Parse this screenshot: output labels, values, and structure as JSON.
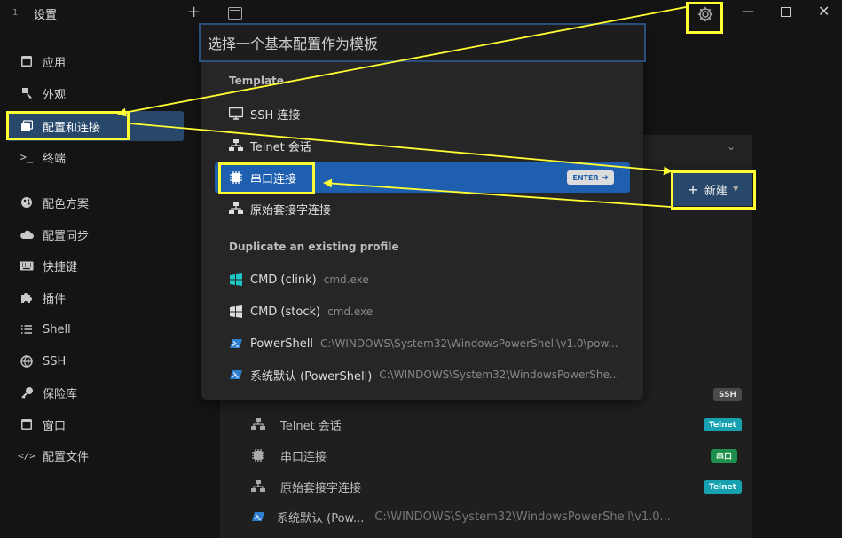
{
  "titlebar": {
    "tab_number": "1",
    "title": "设置"
  },
  "sidebar": {
    "items": [
      {
        "label": "应用",
        "icon": "app-window-icon"
      },
      {
        "label": "外观",
        "icon": "palette-icon"
      },
      {
        "label": "配置和连接",
        "icon": "profiles-icon",
        "active": true
      },
      {
        "label": "终端",
        "icon": "terminal-icon"
      },
      {
        "label": "配色方案",
        "icon": "color-scheme-icon"
      },
      {
        "label": "配置同步",
        "icon": "cloud-icon"
      },
      {
        "label": "快捷键",
        "icon": "keyboard-icon"
      },
      {
        "label": "插件",
        "icon": "puzzle-icon"
      },
      {
        "label": "Shell",
        "icon": "list-icon"
      },
      {
        "label": "SSH",
        "icon": "globe-icon"
      },
      {
        "label": "保险库",
        "icon": "key-icon"
      },
      {
        "label": "窗口",
        "icon": "window-icon"
      },
      {
        "label": "配置文件",
        "icon": "code-icon"
      }
    ]
  },
  "palette": {
    "placeholder": "选择一个基本配置作为模板",
    "section_template": "Template",
    "templates": [
      {
        "label": "SSH 连接",
        "icon": "monitor-icon"
      },
      {
        "label": "Telnet 会话",
        "icon": "network-icon"
      },
      {
        "label": "串口连接",
        "icon": "chip-icon",
        "selected": true
      },
      {
        "label": "原始套接字连接",
        "icon": "network-icon"
      }
    ],
    "enter_label": "ENTER",
    "section_duplicate": "Duplicate an existing profile",
    "profiles": [
      {
        "label": "CMD (clink)",
        "sub": "cmd.exe",
        "icon": "windows-icon",
        "color": "#1ec6c6"
      },
      {
        "label": "CMD (stock)",
        "sub": "cmd.exe",
        "icon": "windows-icon",
        "color": "#dcdcdc"
      },
      {
        "label": "PowerShell",
        "sub": "C:\\WINDOWS\\System32\\WindowsPowerShell\\v1.0\\pow...",
        "icon": "powershell-icon",
        "color": "#2f7fd0"
      },
      {
        "label": "系统默认 (PowerShell)",
        "sub": "C:\\WINDOWS\\System32\\WindowsPowerShe...",
        "icon": "powershell-icon",
        "color": "#2f7fd0"
      }
    ]
  },
  "main": {
    "new_button": "新建",
    "rows": [
      {
        "label": "Telnet 会话",
        "icon": "network-icon",
        "badge": "Telnet"
      },
      {
        "label": "串口连接",
        "icon": "chip-icon",
        "badge": "串口"
      },
      {
        "label": "原始套接字连接",
        "icon": "network-icon",
        "badge": "Telnet"
      },
      {
        "label": "系统默认 (Pow...",
        "sub": "C:\\WINDOWS\\System32\\WindowsPowerShell\\v1.0...",
        "icon": "powershell-icon"
      }
    ],
    "ssh_badge": "SSH"
  },
  "colors": {
    "accent": "#1f5fb0",
    "active_nav": "#27486a",
    "annotation": "#ffff33",
    "badge_ssh": "#4a4a4a",
    "badge_telnet": "#16a0b0",
    "badge_serial": "#1f8f4e"
  }
}
